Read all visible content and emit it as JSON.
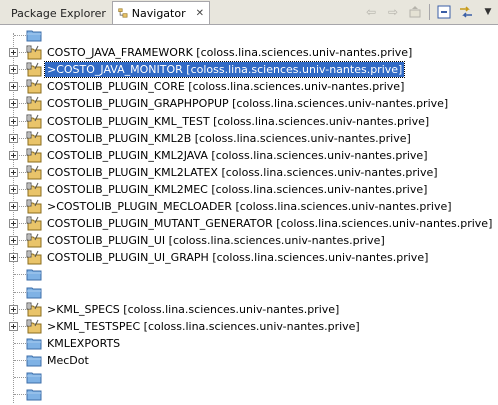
{
  "tabs": [
    {
      "label": "Package Explorer",
      "active": false
    },
    {
      "label": "Navigator",
      "active": true,
      "close": "✕"
    }
  ],
  "toolbar": [
    "back-icon",
    "forward-icon",
    "up-icon",
    "collapse-all-icon",
    "link-with-editor-icon",
    "view-menu-icon"
  ],
  "tree": {
    "rows": [
      {
        "type": "folder",
        "label": "",
        "expandable": false
      },
      {
        "type": "project",
        "label": "COSTO_JAVA_FRAMEWORK  [coloss.lina.sciences.univ-nantes.prive]",
        "expandable": true,
        "selected": false
      },
      {
        "type": "project",
        "label": ">COSTO_JAVA_MONITOR  [coloss.lina.sciences.univ-nantes.prive]",
        "expandable": true,
        "selected": true
      },
      {
        "type": "project",
        "label": "COSTOLIB_PLUGIN_CORE  [coloss.lina.sciences.univ-nantes.prive]",
        "expandable": true
      },
      {
        "type": "project",
        "label": "COSTOLIB_PLUGIN_GRAPHPOPUP  [coloss.lina.sciences.univ-nantes.prive]",
        "expandable": true
      },
      {
        "type": "project",
        "label": "COSTOLIB_PLUGIN_KML_TEST  [coloss.lina.sciences.univ-nantes.prive]",
        "expandable": true
      },
      {
        "type": "project",
        "label": "COSTOLIB_PLUGIN_KML2B  [coloss.lina.sciences.univ-nantes.prive]",
        "expandable": true
      },
      {
        "type": "project",
        "label": "COSTOLIB_PLUGIN_KML2JAVA  [coloss.lina.sciences.univ-nantes.prive]",
        "expandable": true
      },
      {
        "type": "project",
        "label": "COSTOLIB_PLUGIN_KML2LATEX  [coloss.lina.sciences.univ-nantes.prive]",
        "expandable": true
      },
      {
        "type": "project",
        "label": "COSTOLIB_PLUGIN_KML2MEC  [coloss.lina.sciences.univ-nantes.prive]",
        "expandable": true
      },
      {
        "type": "project",
        "label": ">COSTOLIB_PLUGIN_MECLOADER  [coloss.lina.sciences.univ-nantes.prive]",
        "expandable": true
      },
      {
        "type": "project",
        "label": "COSTOLIB_PLUGIN_MUTANT_GENERATOR  [coloss.lina.sciences.univ-nantes.prive]",
        "expandable": true
      },
      {
        "type": "project",
        "label": "COSTOLIB_PLUGIN_UI  [coloss.lina.sciences.univ-nantes.prive]",
        "expandable": true
      },
      {
        "type": "project",
        "label": "COSTOLIB_PLUGIN_UI_GRAPH  [coloss.lina.sciences.univ-nantes.prive]",
        "expandable": true
      },
      {
        "type": "folder",
        "label": "",
        "expandable": false
      },
      {
        "type": "folder",
        "label": "",
        "expandable": false
      },
      {
        "type": "project",
        "label": ">KML_SPECS  [coloss.lina.sciences.univ-nantes.prive]",
        "expandable": true
      },
      {
        "type": "project",
        "label": ">KML_TESTSPEC  [coloss.lina.sciences.univ-nantes.prive]",
        "expandable": true
      },
      {
        "type": "folder",
        "label": "KMLEXPORTS",
        "expandable": false
      },
      {
        "type": "folder",
        "label": "MecDot",
        "expandable": false
      },
      {
        "type": "folder",
        "label": "",
        "expandable": false
      },
      {
        "type": "folder",
        "label": "",
        "expandable": false
      }
    ]
  },
  "colors": {
    "selection": "#316ac5",
    "folder": "#7fb2e5",
    "tabbar": "#e8e6dd"
  }
}
